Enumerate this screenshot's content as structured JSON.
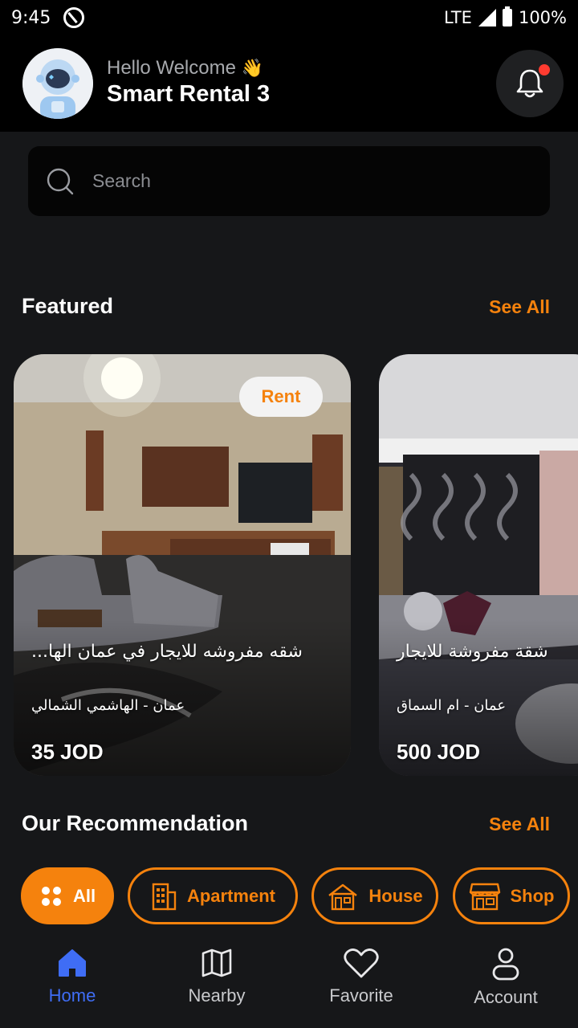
{
  "status": {
    "time": "9:45",
    "network": "LTE",
    "battery": "100%"
  },
  "header": {
    "greeting": "Hello Welcome",
    "greeting_emoji": "👋",
    "app_name": "Smart Rental 3"
  },
  "search": {
    "placeholder": "Search",
    "value": ""
  },
  "featured": {
    "title": "Featured",
    "see_all": "See All",
    "cards": [
      {
        "badge": "Rent",
        "title": "...شقه مفروشه للايجار في عمان الها",
        "location": "عمان - الهاشمي الشمالي",
        "price": "35 JOD"
      },
      {
        "title": "شقة مفروشة للايجار",
        "location": "عمان - ام السماق",
        "price": "500 JOD"
      }
    ]
  },
  "recommendation": {
    "title": "Our Recommendation",
    "see_all": "See All",
    "filters": [
      {
        "label": "All",
        "icon": "grid-icon",
        "active": true
      },
      {
        "label": "Apartment",
        "icon": "building-icon",
        "active": false
      },
      {
        "label": "House",
        "icon": "house-icon",
        "active": false
      },
      {
        "label": "Shop",
        "icon": "shop-icon",
        "active": false
      }
    ]
  },
  "nav": [
    {
      "label": "Home",
      "icon": "home-icon",
      "active": true
    },
    {
      "label": "Nearby",
      "icon": "map-icon",
      "active": false
    },
    {
      "label": "Favorite",
      "icon": "heart-icon",
      "active": false
    },
    {
      "label": "Account",
      "icon": "user-icon",
      "active": false
    }
  ],
  "colors": {
    "accent": "#f5820d",
    "nav_active": "#3f6df5",
    "background": "#161719",
    "notification_dot": "#ff3b30"
  }
}
